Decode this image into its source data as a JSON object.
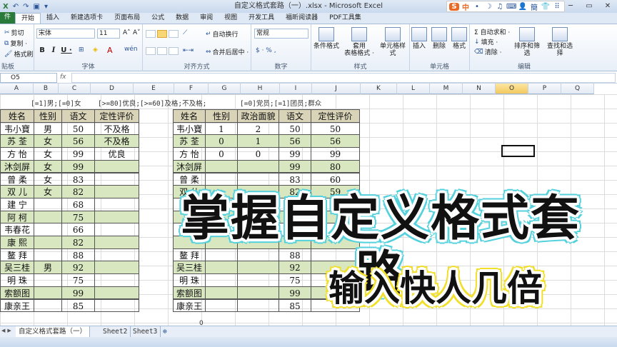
{
  "window": {
    "title": "自定义格式套路（一）.xlsx - Microsoft Excel",
    "controls": [
      "─",
      "▭",
      "✕"
    ]
  },
  "ime": {
    "logo": "S",
    "mode": "中",
    "items": [
      "•",
      "☽",
      "♫",
      "⌨",
      "👤",
      "簡",
      "👕",
      "⠿"
    ]
  },
  "tabs": [
    "件",
    "开始",
    "插入",
    "新建选项卡",
    "页面布局",
    "公式",
    "数据",
    "审阅",
    "视图",
    "开发工具",
    "福昕阅读器",
    "PDF工具集"
  ],
  "ribbon": {
    "clipboard": {
      "cut": "剪切",
      "copy": "复制 ·",
      "painter": "格式刷",
      "label": "贴板"
    },
    "font": {
      "name": "宋体",
      "size": "11",
      "grow": "A˄",
      "shrink": "A˅",
      "bold": "B",
      "italic": "I",
      "underline": "U ·",
      "label": "字体",
      "wen": "wén"
    },
    "alignment": {
      "wrap": "自动换行",
      "merge": "合并后居中 ·",
      "label": "对齐方式"
    },
    "number": {
      "format": "常规",
      "label": "数字"
    },
    "styles": {
      "conditional": "条件格式",
      "table": "套用\n表格格式 ·",
      "cell": "单元格样式",
      "label": "样式"
    },
    "cells": {
      "insert": "插入",
      "delete": "删除",
      "format": "格式",
      "label": "单元格"
    },
    "editing": {
      "autosum": "Σ 自动求和 ·",
      "fill": "填充 ·",
      "clear": "清除 ·",
      "sort": "排序和筛选",
      "find": "查找和选择",
      "label": "编辑"
    }
  },
  "formula_bar": {
    "name_box": "O5",
    "fx": "fx",
    "value": ""
  },
  "columns": [
    "A",
    "B",
    "C",
    "D",
    "E",
    "F",
    "G",
    "H",
    "I",
    "J",
    "K",
    "L",
    "M",
    "N",
    "O",
    "P",
    "Q"
  ],
  "notes": {
    "note1": "[=1]男;[=0]女",
    "note2": "[>=80]优良;[>=60]及格;不及格;",
    "note3": "[=0]党员;[=1]团员;群众"
  },
  "table1": {
    "headers": [
      "姓名",
      "性别",
      "语文",
      "定性评价"
    ],
    "rows": [
      [
        "韦小寶",
        "男",
        "50",
        "不及格"
      ],
      [
        "苏 荃",
        "女",
        "56",
        "不及格"
      ],
      [
        "方 怡",
        "女",
        "99",
        "优良"
      ],
      [
        "沐剑屏",
        "女",
        "99",
        ""
      ],
      [
        "曾 柔",
        "女",
        "83",
        ""
      ],
      [
        "双 儿",
        "女",
        "82",
        ""
      ],
      [
        "建 宁",
        "",
        "68",
        ""
      ],
      [
        "阿 柯",
        "",
        "75",
        ""
      ],
      [
        "韦春花",
        "",
        "66",
        ""
      ],
      [
        "康 熙",
        "",
        "82",
        ""
      ],
      [
        "鳌 拜",
        "",
        "88",
        ""
      ],
      [
        "吴三桂",
        "男",
        "92",
        ""
      ],
      [
        "明 珠",
        "",
        "75",
        ""
      ],
      [
        "索额图",
        "",
        "99",
        ""
      ],
      [
        "康亲王",
        "",
        "85",
        ""
      ]
    ]
  },
  "table2": {
    "headers": [
      "姓名",
      "性别",
      "政治面貌",
      "语文",
      "定性评价"
    ],
    "rows": [
      [
        "韦小寶",
        "1",
        "2",
        "50",
        "50"
      ],
      [
        "苏 荃",
        "0",
        "1",
        "56",
        "56"
      ],
      [
        "方 怡",
        "0",
        "0",
        "99",
        "99"
      ],
      [
        "沐剑屏",
        "",
        "",
        "99",
        "80"
      ],
      [
        "曾 柔",
        "",
        "",
        "83",
        "60"
      ],
      [
        "双 儿",
        "",
        "",
        "82",
        "59"
      ],
      [
        "",
        "",
        "",
        "68",
        ""
      ],
      [
        "",
        "",
        "",
        "",
        ""
      ],
      [
        "",
        "",
        "",
        "",
        ""
      ],
      [
        "",
        "",
        "",
        "",
        ""
      ],
      [
        "鳌 拜",
        "",
        "",
        "88",
        ""
      ],
      [
        "吴三桂",
        "",
        "",
        "92",
        ""
      ],
      [
        "明 珠",
        "",
        "",
        "75",
        ""
      ],
      [
        "索额图",
        "",
        "",
        "99",
        ""
      ],
      [
        "康亲王",
        "",
        "",
        "85",
        ""
      ]
    ]
  },
  "captions": {
    "main": "掌握自定义格式套路",
    "sub": "输入快人几倍"
  },
  "sheets": [
    "自定义格式套路（一）",
    "Sheet2",
    "Sheet3"
  ],
  "status": {
    "value": "0"
  },
  "colors": {
    "header_fill": "#d9d4b8",
    "green_fill": "#d8e7c0",
    "caption1_outline": "#54d1dc",
    "caption2_outline": "#f1df2a",
    "file_tab": "#2a7a3a"
  }
}
